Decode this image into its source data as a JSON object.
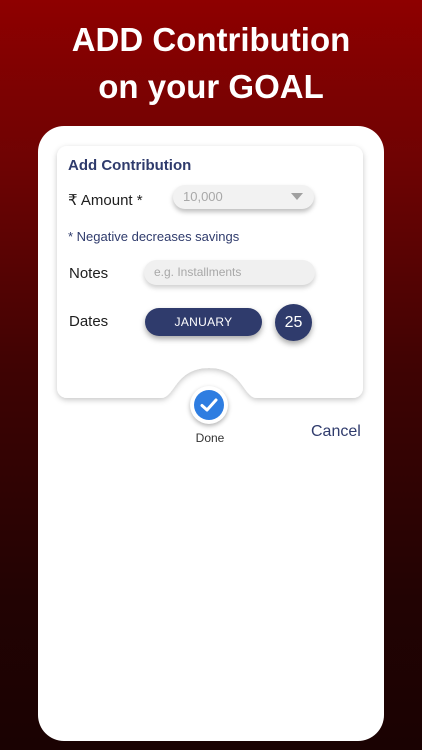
{
  "headline": {
    "line1": "ADD Contribution",
    "line2": "on your GOAL"
  },
  "form": {
    "title": "Add Contribution",
    "amount_label": "₹ Amount *",
    "amount_value": "10,000",
    "negative_hint": "* Negative decreases savings",
    "notes_label": "Notes",
    "notes_placeholder": "e.g. Installments",
    "dates_label": "Dates",
    "month": "JANUARY",
    "day": "25"
  },
  "actions": {
    "done_label": "Done",
    "cancel_label": "Cancel"
  },
  "colors": {
    "background_top": "#8e0000",
    "background_bottom": "#1a0202",
    "accent_navy": "#2f3b6c",
    "done_blue": "#2e7de1"
  },
  "icons": {
    "done": "check-icon",
    "amount_dropdown": "chevron-down-icon"
  }
}
